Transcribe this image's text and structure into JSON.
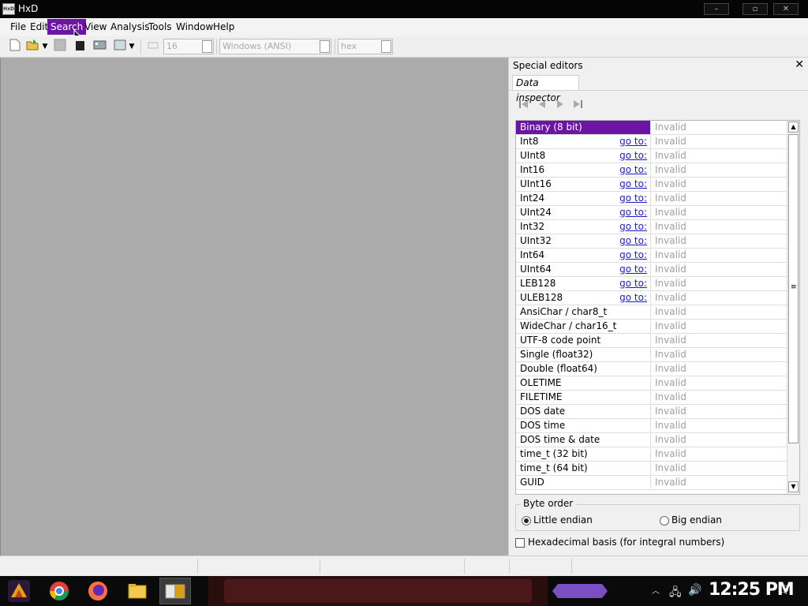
{
  "window": {
    "title": "HxD",
    "app_icon_text": "HxD",
    "minimize": "–",
    "maximize": "▫",
    "close": "✕"
  },
  "menu": [
    "File",
    "Edit",
    "Search",
    "View",
    "Analysis",
    "Tools",
    "Window",
    "Help"
  ],
  "menu_active": "Search",
  "toolbar": {
    "bytes_per_row": "16",
    "charset": "Windows (ANSI)",
    "offset_base": "hex"
  },
  "panel": {
    "title": "Special editors",
    "tab": "Data inspector",
    "goto_label": "go to:",
    "invalid_label": "Invalid",
    "rows": [
      {
        "name": "Binary (8 bit)",
        "goto": false
      },
      {
        "name": "Int8",
        "goto": true
      },
      {
        "name": "UInt8",
        "goto": true
      },
      {
        "name": "Int16",
        "goto": true
      },
      {
        "name": "UInt16",
        "goto": true
      },
      {
        "name": "Int24",
        "goto": true
      },
      {
        "name": "UInt24",
        "goto": true
      },
      {
        "name": "Int32",
        "goto": true
      },
      {
        "name": "UInt32",
        "goto": true
      },
      {
        "name": "Int64",
        "goto": true
      },
      {
        "name": "UInt64",
        "goto": true
      },
      {
        "name": "LEB128",
        "goto": true
      },
      {
        "name": "ULEB128",
        "goto": true
      },
      {
        "name": "AnsiChar / char8_t",
        "goto": false
      },
      {
        "name": "WideChar / char16_t",
        "goto": false
      },
      {
        "name": "UTF-8 code point",
        "goto": false
      },
      {
        "name": "Single (float32)",
        "goto": false
      },
      {
        "name": "Double (float64)",
        "goto": false
      },
      {
        "name": "OLETIME",
        "goto": false
      },
      {
        "name": "FILETIME",
        "goto": false
      },
      {
        "name": "DOS date",
        "goto": false
      },
      {
        "name": "DOS time",
        "goto": false
      },
      {
        "name": "DOS time & date",
        "goto": false
      },
      {
        "name": "time_t (32 bit)",
        "goto": false
      },
      {
        "name": "time_t (64 bit)",
        "goto": false
      },
      {
        "name": "GUID",
        "goto": false
      }
    ],
    "selected_row": "Binary (8 bit)",
    "byte_order": {
      "legend": "Byte order",
      "little": "Little endian",
      "big": "Big endian",
      "selected": "Little endian"
    },
    "hex_basis_label": "Hexadecimal basis (for integral numbers)",
    "hex_basis_checked": false
  },
  "taskbar": {
    "clock": "12:25 PM"
  },
  "colors": {
    "accent": "#6c14a3",
    "link": "#1d1dcc",
    "workspace": "#ababab"
  }
}
